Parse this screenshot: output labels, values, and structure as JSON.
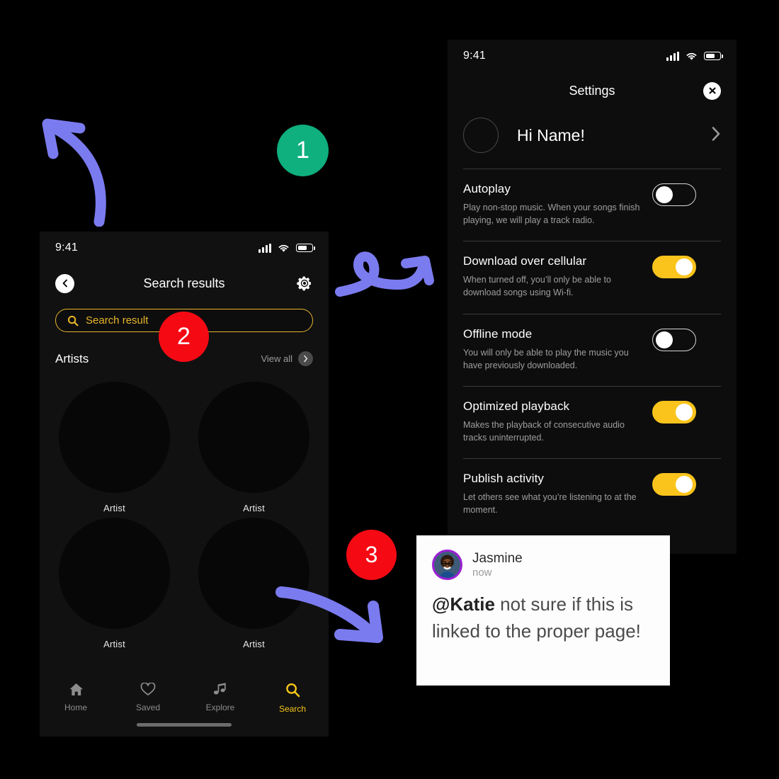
{
  "search_phone": {
    "status_bar": {
      "time": "9:41",
      "signal_icon": "cellular-bars-icon",
      "wifi_icon": "wifi-icon",
      "battery_icon": "battery-icon"
    },
    "nav": {
      "back_icon": "chevron-left-icon",
      "title": "Search results",
      "settings_icon": "gear-icon"
    },
    "search": {
      "icon": "search-icon",
      "value": "Search result",
      "placeholder": "Search result"
    },
    "section": {
      "title": "Artists",
      "view_all_label": "View all",
      "view_all_icon": "chevron-right-icon"
    },
    "artists": [
      {
        "name": "Artist"
      },
      {
        "name": "Artist"
      },
      {
        "name": "Artist"
      },
      {
        "name": "Artist"
      }
    ],
    "tabs": [
      {
        "label": "Home",
        "icon": "home-icon",
        "active": false
      },
      {
        "label": "Saved",
        "icon": "heart-icon",
        "active": false
      },
      {
        "label": "Explore",
        "icon": "music-note-icon",
        "active": false
      },
      {
        "label": "Search",
        "icon": "search-icon",
        "active": true
      }
    ],
    "accent_color": "#F5C518"
  },
  "settings_phone": {
    "status_bar": {
      "time": "9:41",
      "signal_icon": "cellular-bars-icon",
      "wifi_icon": "wifi-icon",
      "battery_icon": "battery-icon"
    },
    "header": {
      "title": "Settings",
      "close_icon": "close-icon"
    },
    "profile": {
      "greeting": "Hi Name!",
      "avatar_icon": "avatar-placeholder",
      "chevron_icon": "chevron-right-icon"
    },
    "items": [
      {
        "label": "Autoplay",
        "description": "Play non-stop music. When your songs finish playing, we will play a track radio.",
        "toggle_on": false
      },
      {
        "label": "Download over cellular",
        "description": "When turned off, you’ll only be able to download songs using Wi-fi.",
        "toggle_on": true
      },
      {
        "label": "Offline mode",
        "description": "You will only be able to play the music you have previously downloaded.",
        "toggle_on": false
      },
      {
        "label": "Optimized playback",
        "description": "Makes the playback of consecutive audio tracks uninterrupted.",
        "toggle_on": true
      },
      {
        "label": "Publish activity",
        "description": "Let others see what you’re listening to at the moment.",
        "toggle_on": true
      }
    ],
    "toggle_on_color": "#FBC41C"
  },
  "comment_card": {
    "author": "Jasmine",
    "timestamp": "now",
    "mention": "@Katie",
    "body": " not sure if this is linked to the proper page!",
    "avatar_icon": "user-photo-avatar"
  },
  "annotations": {
    "badges": [
      {
        "number": "1",
        "color": "#0FAF7E"
      },
      {
        "number": "2",
        "color": "#F50A14"
      },
      {
        "number": "3",
        "color": "#F50A14"
      }
    ],
    "arrow_color": "#7B7BF0",
    "arrows": [
      {
        "name": "arrow-up-left",
        "points_to": "top-left"
      },
      {
        "name": "arrow-loop-right",
        "points_to": "right"
      },
      {
        "name": "arrow-down-right",
        "points_to": "bottom-right"
      }
    ]
  }
}
